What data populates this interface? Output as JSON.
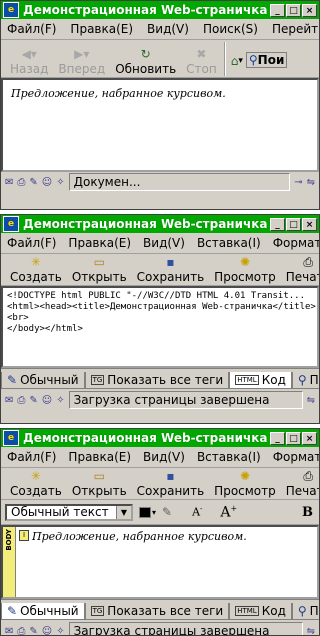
{
  "window1": {
    "title": "Демонстрационная Web-страничка",
    "controls": {
      "minimize": "_",
      "maximize": "□",
      "close": "×"
    },
    "menu": [
      "Файл(F)",
      "Правка(E)",
      "Вид(V)",
      "Поиск(S)",
      "Перейти(G)"
    ],
    "toolbar": {
      "back": "Назад",
      "forward": "Вперед",
      "refresh": "Обновить",
      "stop": "Стоп",
      "search": "Пои"
    },
    "content_text": "Предложение, набранное курсивом.",
    "status": "Докумен..."
  },
  "window2": {
    "title": "Демонстрационная Web-страничка",
    "menu": [
      "Файл(F)",
      "Правка(E)",
      "Вид(V)",
      "Вставка(I)",
      "Формат(O)"
    ],
    "toolbar": {
      "create": "Создать",
      "open": "Открыть",
      "save": "Сохранить",
      "preview": "Просмотр",
      "print": "Печать"
    },
    "code_lines": [
      "<!DOCTYPE html PUBLIC \"-//W3C//DTD HTML 4.01 Transit...",
      "<html><head><title>Демонстрационная Web-страничка</title>",
      "<br>",
      "</body></html>"
    ],
    "tabs": {
      "normal": "Обычный",
      "show_tags": "Показать все теги",
      "code": "Код",
      "preview": "Предва"
    },
    "tag_label": "TG",
    "html_label": "HTML",
    "status": "Загрузка страницы завершена"
  },
  "window3": {
    "title": "Демонстрационная Web-страничка",
    "menu": [
      "Файл(F)",
      "Правка(E)",
      "Вид(V)",
      "Вставка(I)",
      "Формат(O)"
    ],
    "toolbar": {
      "create": "Создать",
      "open": "Открыть",
      "save": "Сохранить",
      "preview": "Просмотр",
      "print": "Печать"
    },
    "style_select": "Обычный текст",
    "body_tag": "BODY",
    "content_text": "Предложение, набранное курсивом.",
    "tabs": {
      "normal": "Обычный",
      "show_tags": "Показать все теги",
      "code": "Код",
      "preview": "Предва"
    },
    "tag_label": "TG",
    "html_label": "HTML",
    "status": "Загрузка страницы завершена"
  },
  "colors": {
    "titlebar": "#00a800",
    "chrome": "#d4d0c8"
  }
}
